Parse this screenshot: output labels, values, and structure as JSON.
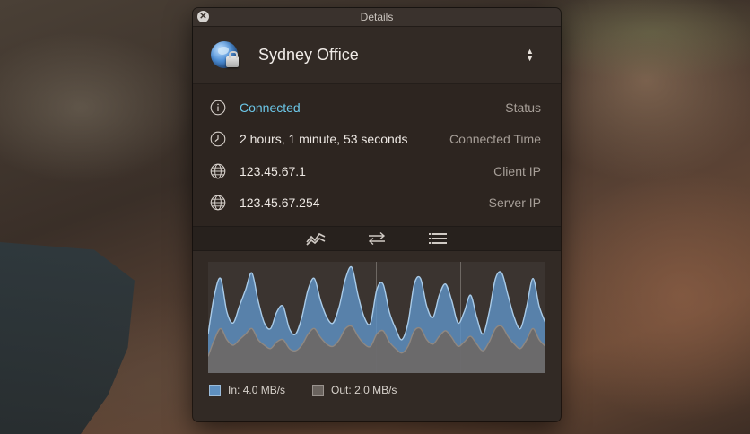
{
  "window": {
    "title": "Details"
  },
  "vpn": {
    "name": "Sydney Office"
  },
  "info_rows": [
    {
      "value": "Connected",
      "label": "Status"
    },
    {
      "value": "2 hours, 1 minute, 53 seconds",
      "label": "Connected Time"
    },
    {
      "value": "123.45.67.1",
      "label": "Client IP"
    },
    {
      "value": "123.45.67.254",
      "label": "Server IP"
    }
  ],
  "icons": {
    "status": "info-icon",
    "time": "clock-icon",
    "client_ip": "globe-icon",
    "server_ip": "globe-icon",
    "tab_graph": "chart-trend-icon",
    "tab_transfer": "transfer-arrows-icon",
    "tab_list": "list-icon"
  },
  "legend": {
    "in_label": "In:",
    "in_value": "4.0 MB/s",
    "out_label": "Out:",
    "out_value": "2.0 MB/s"
  },
  "colors": {
    "connected": "#6cc7e8",
    "in_series": "#5e8fbf",
    "out_series": "#6a635e"
  },
  "chart_data": {
    "type": "area",
    "series": [
      {
        "name": "In",
        "values": [
          0.35,
          0.7,
          0.85,
          0.55,
          0.45,
          0.6,
          0.75,
          0.9,
          0.65,
          0.45,
          0.4,
          0.55,
          0.6,
          0.4,
          0.35,
          0.5,
          0.75,
          0.85,
          0.65,
          0.5,
          0.45,
          0.6,
          0.85,
          0.95,
          0.7,
          0.5,
          0.45,
          0.75,
          0.8,
          0.55,
          0.4,
          0.3,
          0.45,
          0.8,
          0.85,
          0.6,
          0.5,
          0.7,
          0.8,
          0.65,
          0.45,
          0.55,
          0.7,
          0.5,
          0.35,
          0.55,
          0.85,
          0.9,
          0.7,
          0.5,
          0.4,
          0.6,
          0.85,
          0.6,
          0.45
        ]
      },
      {
        "name": "Out",
        "values": [
          0.15,
          0.3,
          0.4,
          0.3,
          0.25,
          0.3,
          0.35,
          0.4,
          0.3,
          0.25,
          0.22,
          0.28,
          0.3,
          0.22,
          0.2,
          0.25,
          0.35,
          0.4,
          0.32,
          0.26,
          0.24,
          0.3,
          0.4,
          0.42,
          0.33,
          0.26,
          0.24,
          0.35,
          0.38,
          0.28,
          0.22,
          0.18,
          0.24,
          0.38,
          0.4,
          0.3,
          0.26,
          0.33,
          0.38,
          0.32,
          0.24,
          0.28,
          0.33,
          0.26,
          0.2,
          0.28,
          0.4,
          0.42,
          0.33,
          0.26,
          0.22,
          0.3,
          0.4,
          0.3,
          0.24
        ]
      }
    ],
    "ylim": [
      0,
      1
    ]
  }
}
